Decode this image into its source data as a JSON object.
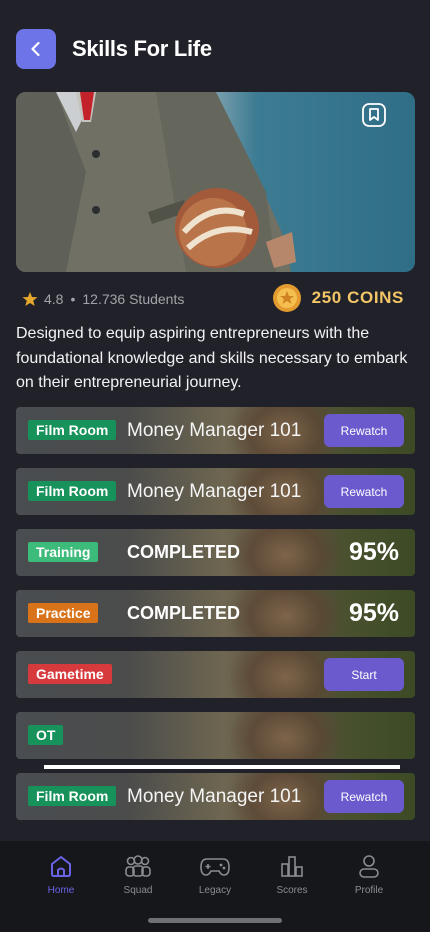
{
  "header": {
    "title": "Skills For Life"
  },
  "course": {
    "rating": "4.8",
    "students": "12.736 Students",
    "coins": "250 COINS",
    "description": "Designed to equip aspiring entrepreneurs with the foundational knowledge and skills necessary to embark on their entrepreneurial journey."
  },
  "rows": [
    {
      "tag": "Film Room",
      "title": "Money Manager 101",
      "button": "Rewatch"
    },
    {
      "tag": "Film Room",
      "title": "Money Manager 101",
      "button": "Rewatch"
    },
    {
      "tag": "Training",
      "status": "COMPLETED",
      "percent": "95%"
    },
    {
      "tag": "Practice",
      "status": "COMPLETED",
      "percent": "95%"
    },
    {
      "tag": "Gametime",
      "button": "Start"
    },
    {
      "tag": "OT"
    },
    {
      "tag": "Film Room",
      "title": "Money Manager 101",
      "button": "Rewatch"
    }
  ],
  "nav": [
    {
      "label": "Home",
      "icon": "home-icon",
      "active": true
    },
    {
      "label": "Squad",
      "icon": "squad-icon"
    },
    {
      "label": "Legacy",
      "icon": "gamepad-icon"
    },
    {
      "label": "Scores",
      "icon": "bar-chart-icon"
    },
    {
      "label": "Profile",
      "icon": "profile-icon"
    }
  ],
  "colors": {
    "background": "#212229",
    "accent": "#6a5acd",
    "coin": "#f2c566",
    "film_room": "#17925a",
    "training": "#3dbb7a",
    "practice": "#d8731a",
    "gametime": "#d63a3c"
  }
}
